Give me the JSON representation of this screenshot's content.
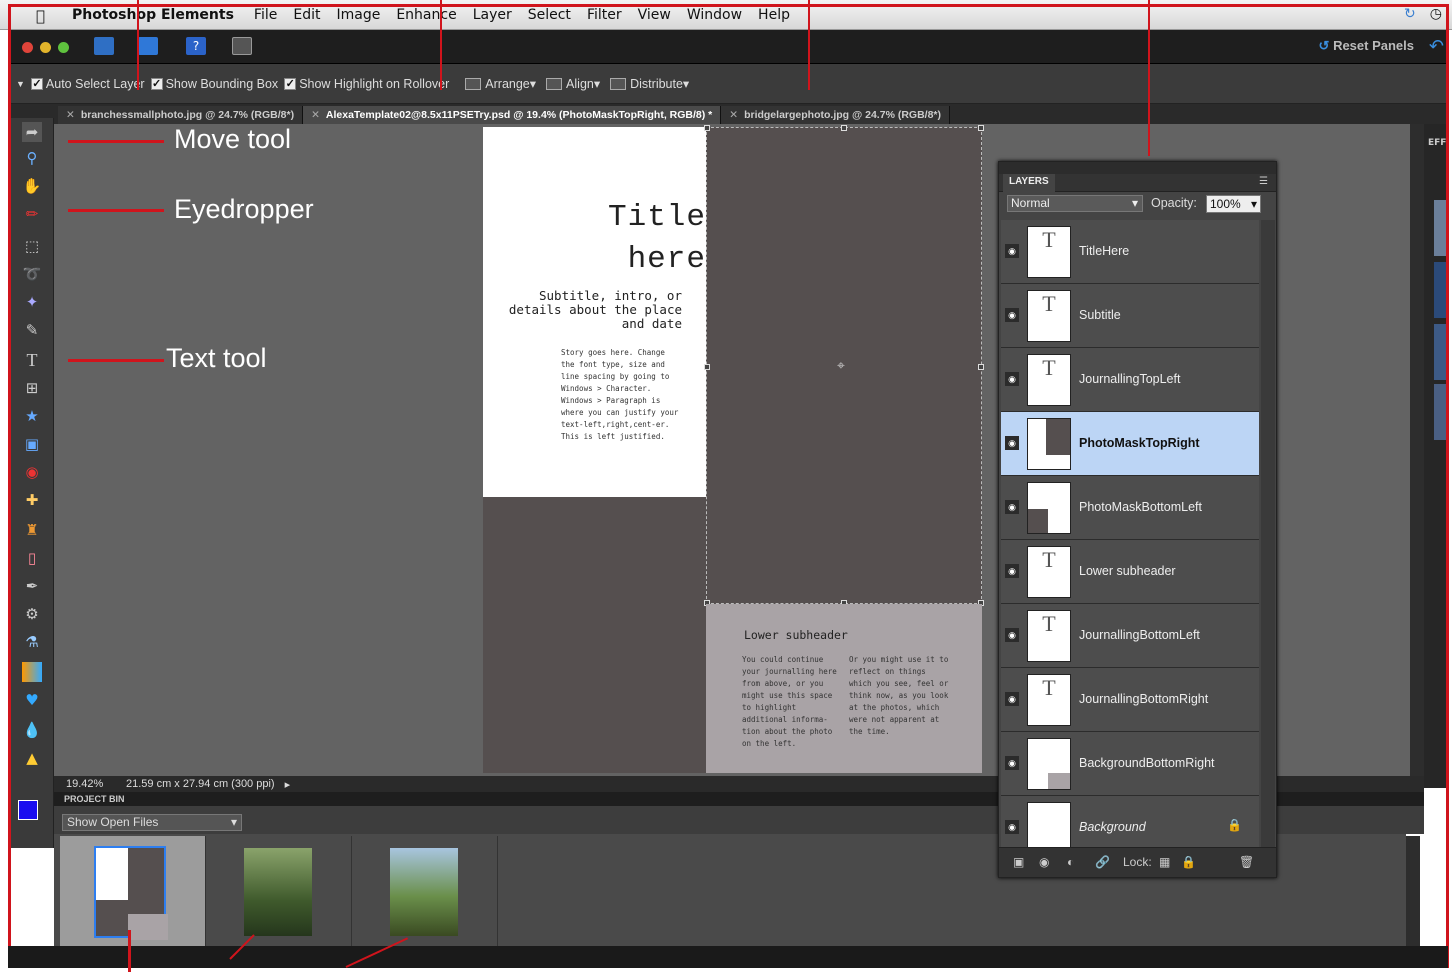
{
  "menubar": {
    "app_name": "Photoshop Elements",
    "items": [
      "File",
      "Edit",
      "Image",
      "Enhance",
      "Layer",
      "Select",
      "Filter",
      "View",
      "Window",
      "Help"
    ]
  },
  "appbar": {
    "reset_panels": "Reset Panels"
  },
  "options": {
    "auto_select": "Auto Select Layer",
    "bounding_box": "Show Bounding Box",
    "highlight": "Show Highlight on Rollover",
    "arrange": "Arrange",
    "align": "Align",
    "distribute": "Distribute"
  },
  "tabs": [
    {
      "label": "branchessmallphoto.jpg @ 24.7% (RGB/8*)"
    },
    {
      "label": "AlexaTemplate02@8.5x11PSETry.psd @ 19.4% (PhotoMaskTopRight, RGB/8) *"
    },
    {
      "label": "bridgelargephoto.jpg @ 24.7% (RGB/8*)"
    }
  ],
  "annotations": {
    "move": "Move tool",
    "eyedropper": "Eyedropper",
    "text": "Text tool"
  },
  "document": {
    "title_line1": "Title",
    "title_line2": "here",
    "subtitle": "Subtitle, intro, or details about  the place and date",
    "story": "Story goes here. Change the font type, size and line spacing by going to Windows > Character. Windows > Paragraph  is where you can justify your text-left,right,cent-er. This is left justified.",
    "lower_header": "Lower subheader",
    "lower_col1": "You could continue your journalling here from above, or you might use this space to highlight additional informa-tion about the photo on the left.",
    "lower_col2": "Or you might use it to reflect on things which you see, feel or think now, as you look at the photos, which were not apparent at the time."
  },
  "status": {
    "zoom": "19.42%",
    "size": "21.59 cm x 27.94 cm (300 ppi)"
  },
  "bin": {
    "header": "PROJECT BIN",
    "select": "Show Open Files"
  },
  "layers": {
    "tab": "LAYERS",
    "blend": "Normal",
    "opacity_label": "Opacity:",
    "opacity_value": "100%",
    "lock_label": "Lock:",
    "items": [
      {
        "name": "TitleHere",
        "type": "text"
      },
      {
        "name": "Subtitle",
        "type": "text"
      },
      {
        "name": "JournallingTopLeft",
        "type": "text"
      },
      {
        "name": "PhotoMaskTopRight",
        "type": "mask",
        "selected": true
      },
      {
        "name": "PhotoMaskBottomLeft",
        "type": "mask"
      },
      {
        "name": "Lower subheader",
        "type": "text"
      },
      {
        "name": "JournallingBottomLeft",
        "type": "text"
      },
      {
        "name": "JournallingBottomRight",
        "type": "text"
      },
      {
        "name": "BackgroundBottomRight",
        "type": "mask"
      },
      {
        "name": "Background",
        "type": "background",
        "locked": true
      }
    ]
  },
  "colors": {
    "accent_red": "#d0141c",
    "selection_blue": "#bcd5f5",
    "foreground_swatch": "#1a0df0"
  }
}
